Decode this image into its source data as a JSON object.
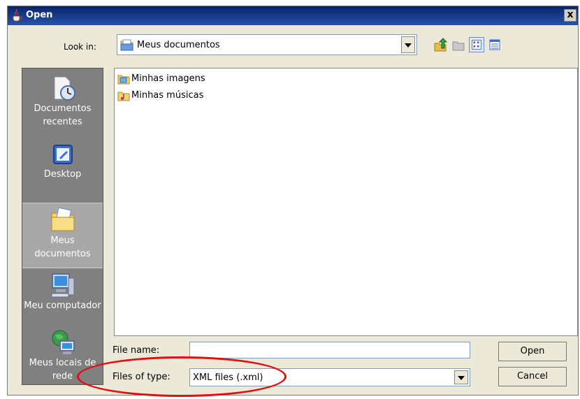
{
  "window": {
    "title": "Open",
    "close_symbol": "x"
  },
  "toolbar": {
    "look_in_label": "Look in:",
    "look_in_value": "Meus documentos",
    "icons": [
      "up-folder-icon",
      "new-folder-icon",
      "list-view-icon",
      "details-view-icon"
    ]
  },
  "places": [
    {
      "label": "Documentos recentes",
      "icon": "recent-documents-icon"
    },
    {
      "label": "Desktop",
      "icon": "desktop-icon"
    },
    {
      "label": "Meus documentos",
      "icon": "my-documents-icon",
      "selected": true
    },
    {
      "label": "Meu computador",
      "icon": "my-computer-icon"
    },
    {
      "label": "Meus locais de rede",
      "icon": "network-places-icon"
    }
  ],
  "files": [
    {
      "name": "Minhas imagens",
      "icon": "pictures-folder-icon"
    },
    {
      "name": "Minhas músicas",
      "icon": "music-folder-icon"
    }
  ],
  "file_name": {
    "label": "File name:",
    "value": ""
  },
  "files_of_type": {
    "label": "Files of type:",
    "value": "XML files (.xml)"
  },
  "buttons": {
    "open": "Open",
    "cancel": "Cancel"
  },
  "colors": {
    "title_bar": "#0a246a",
    "places_bg": "#808080",
    "highlight": "#e01010"
  }
}
